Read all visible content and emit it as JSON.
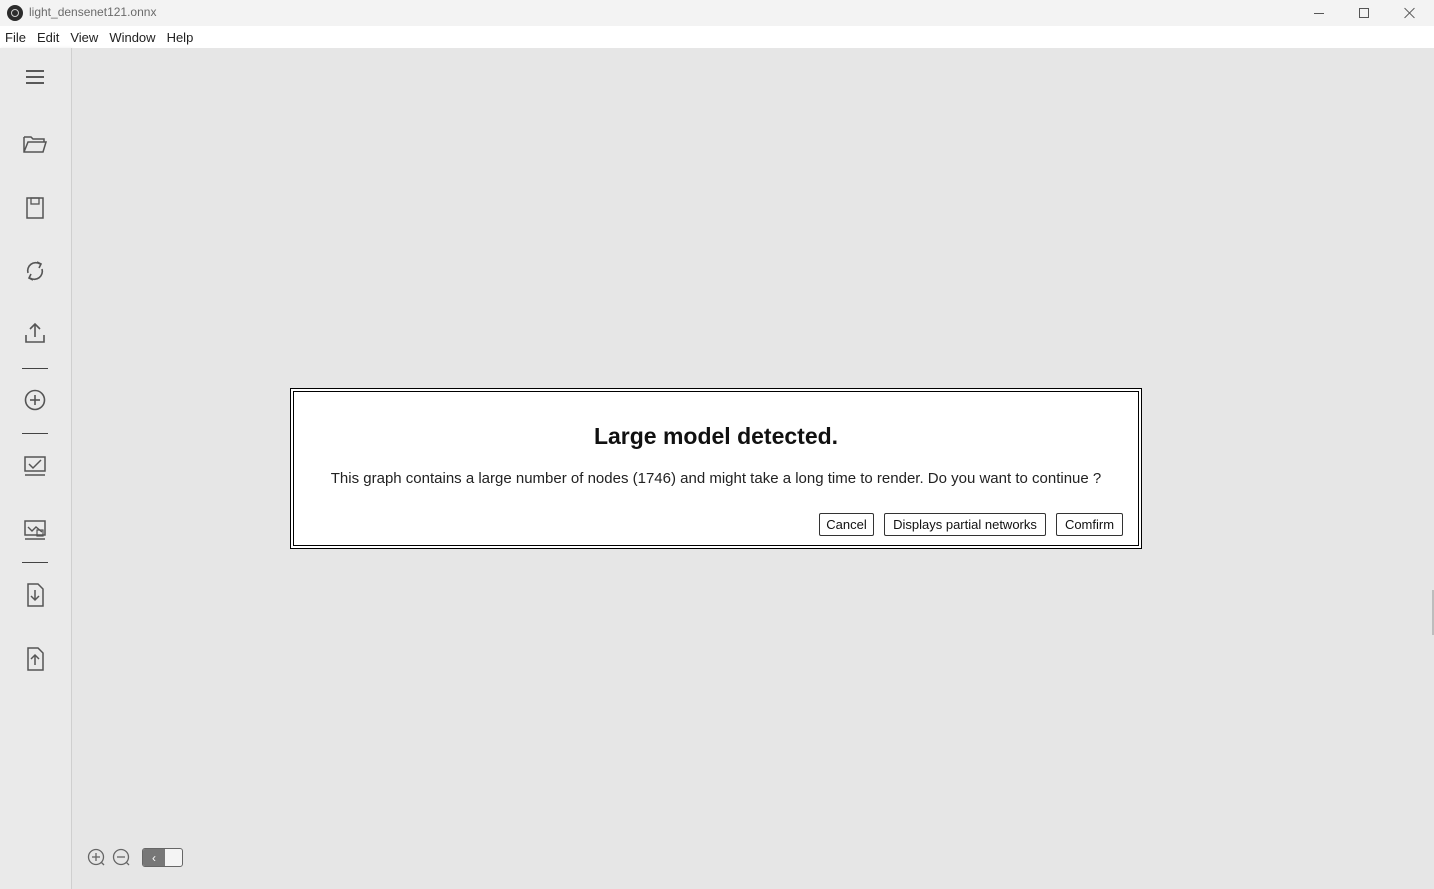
{
  "window": {
    "title": "light_densenet121.onnx"
  },
  "menu": {
    "items": [
      "File",
      "Edit",
      "View",
      "Window",
      "Help"
    ]
  },
  "sidebar": {
    "icons": [
      "menu-icon",
      "open-folder-icon",
      "save-icon",
      "refresh-icon",
      "export-icon",
      "add-icon",
      "checklist-icon",
      "chart-icon",
      "import-file-icon",
      "upload-file-icon"
    ]
  },
  "dialog": {
    "title": "Large model detected.",
    "message": "This graph contains a large number of nodes (1746) and might take a long time to render. Do you want to continue ?",
    "cancel_label": "Cancel",
    "partial_label": "Displays partial networks",
    "confirm_label": "Comfirm"
  },
  "zoom": {
    "toggle_glyph": "‹"
  }
}
